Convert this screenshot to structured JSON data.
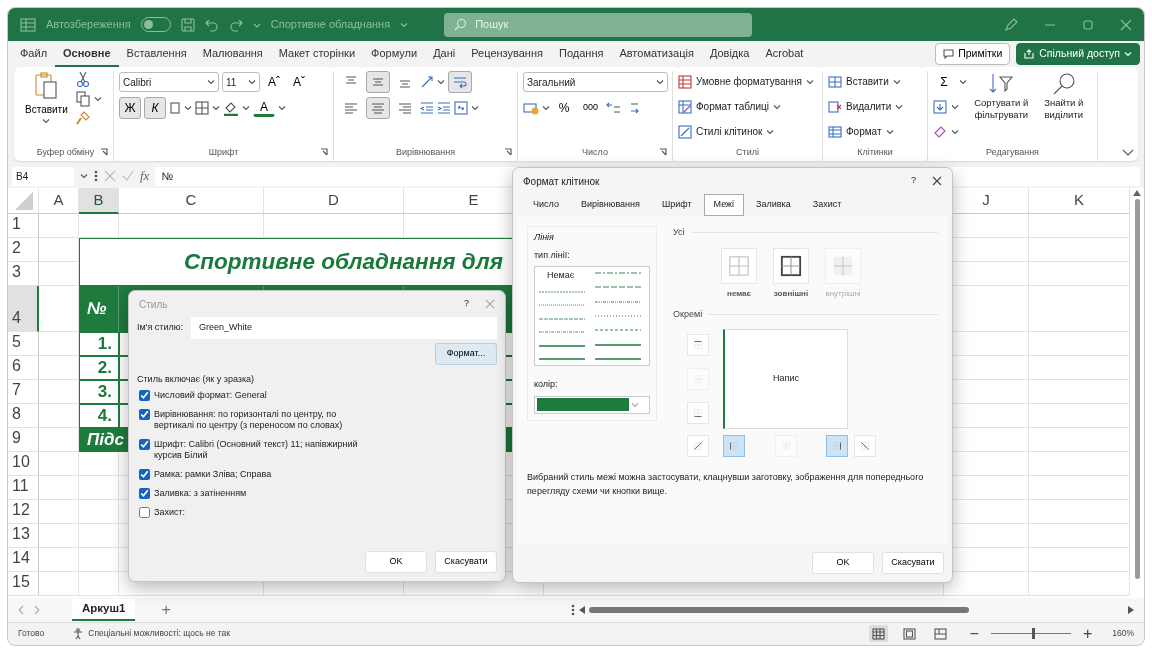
{
  "window": {
    "autosave_label": "Автозбереження",
    "autosave_on": false,
    "document_title": "Спортивне обладнання",
    "search_placeholder": "Пошук"
  },
  "menu_tabs": [
    {
      "label": "Файл",
      "selected": false
    },
    {
      "label": "Основне",
      "selected": true
    },
    {
      "label": "Вставлення",
      "selected": false
    },
    {
      "label": "Малювання",
      "selected": false
    },
    {
      "label": "Макет сторінки",
      "selected": false
    },
    {
      "label": "Формули",
      "selected": false
    },
    {
      "label": "Дані",
      "selected": false
    },
    {
      "label": "Рецензування",
      "selected": false
    },
    {
      "label": "Подання",
      "selected": false
    },
    {
      "label": "Автоматизація",
      "selected": false
    },
    {
      "label": "Довідка",
      "selected": false
    },
    {
      "label": "Acrobat",
      "selected": false
    }
  ],
  "header_buttons": {
    "comments": "Примітки",
    "share": "Спільний доступ"
  },
  "ribbon": {
    "paste": "Вставити",
    "font_name": "Calibri",
    "font_size": "11",
    "grow_font": "Aˆ",
    "shrink_font": "Aˇ",
    "bold": "Ж",
    "bold_on": true,
    "italic": "К",
    "italic_on": true,
    "font_color": "A",
    "align_buttons": [
      {
        "kind": "top",
        "selected": false
      },
      {
        "kind": "middle",
        "selected": true
      },
      {
        "kind": "bottom",
        "selected": false
      },
      {
        "kind": "left",
        "selected": false
      },
      {
        "kind": "center",
        "selected": true
      },
      {
        "kind": "right",
        "selected": false
      }
    ],
    "wrap_on": true,
    "number_format": "Загальний",
    "percent": "%",
    "thousands": "000",
    "styles": [
      "Умовне форматування",
      "Формат таблиці",
      "Стилі клітинок"
    ],
    "cells": [
      "Вставити",
      "Видалити",
      "Формат"
    ],
    "autosum": "Σ",
    "sort": "Сортувати й фільтрувати",
    "find": "Знайти й виділити",
    "groups": [
      {
        "label": "Буфер обміну",
        "launcher": true
      },
      {
        "label": "Шрифт",
        "launcher": true
      },
      {
        "label": "Вирівнювання",
        "launcher": true
      },
      {
        "label": "Число",
        "launcher": true
      },
      {
        "label": "Стилі",
        "launcher": false
      },
      {
        "label": "Клітинки",
        "launcher": false
      },
      {
        "label": "Редагування",
        "launcher": false
      }
    ]
  },
  "formula_bar": {
    "name_box": "B4",
    "function_symbol": "fx",
    "formula": "№"
  },
  "sheet": {
    "columns": [
      {
        "label": "A",
        "selected": false
      },
      {
        "label": "B",
        "selected": true
      },
      {
        "label": "C",
        "selected": false
      },
      {
        "label": "D",
        "selected": false
      },
      {
        "label": "E",
        "selected": false
      },
      {
        "label": "J",
        "selected": false
      },
      {
        "label": "K",
        "selected": false
      }
    ],
    "rows": [
      {
        "label": "1",
        "selected": false
      },
      {
        "label": "2",
        "selected": false
      },
      {
        "label": "3",
        "selected": false
      },
      {
        "label": "4",
        "selected": true
      },
      {
        "label": "5",
        "selected": false
      },
      {
        "label": "6",
        "selected": false
      },
      {
        "label": "7",
        "selected": false
      },
      {
        "label": "8",
        "selected": false
      },
      {
        "label": "9",
        "selected": false
      },
      {
        "label": "10",
        "selected": false
      },
      {
        "label": "11",
        "selected": false
      },
      {
        "label": "12",
        "selected": false
      },
      {
        "label": "13",
        "selected": false
      },
      {
        "label": "14",
        "selected": false
      },
      {
        "label": "15",
        "selected": false
      }
    ],
    "table": {
      "title": "Спортивне обладнання для",
      "number_header": "№",
      "numbers": [
        "1.",
        "2.",
        "3.",
        "4."
      ],
      "total": "Підс"
    }
  },
  "style_dialog": {
    "title": "Стиль",
    "help": "?",
    "name_label": "Ім'я стилю:",
    "name_value": "Green_White",
    "format_button": "Формат...",
    "includes_label": "Стиль включає (як у зразка)",
    "items": [
      {
        "label": "Числовий формат: General",
        "checked": true
      },
      {
        "label": "Вирівнювання: по горизонталі по центру, по вертикалі по центру (з переносом по словах)",
        "checked": true
      },
      {
        "label": "Шрифт: Calibri (Основний текст) 11; напівжирний курсив Білий",
        "checked": true
      },
      {
        "label": "Рамка: рамки Зліва; Справа",
        "checked": true
      },
      {
        "label": "Заливка: з затіненням",
        "checked": true
      },
      {
        "label": "Захист:",
        "checked": false
      }
    ],
    "ok": "OK",
    "cancel": "Скасувати"
  },
  "format_dialog": {
    "title": "Формат клітинок",
    "help": "?",
    "tabs": [
      {
        "label": "Число",
        "selected": false
      },
      {
        "label": "Вирівнювання",
        "selected": false
      },
      {
        "label": "Шрифт",
        "selected": false
      },
      {
        "label": "Межі",
        "selected": true
      },
      {
        "label": "Заливка",
        "selected": false
      },
      {
        "label": "Захист",
        "selected": false
      }
    ],
    "line_group": "Лінія",
    "line_type_label": "тип лінії:",
    "line_none": "Немає",
    "color_label": "колір:",
    "color": "#1e7b3e",
    "presets_label": "Усі",
    "presets": [
      {
        "kind": "none",
        "label": "немає",
        "disabled": false
      },
      {
        "kind": "outline",
        "label": "зовнішні",
        "disabled": false
      },
      {
        "kind": "inside",
        "label": "внутрішні",
        "disabled": true
      }
    ],
    "individual_label": "Окремі",
    "border_buttons": [
      {
        "kind": "top",
        "selected": false,
        "disabled": false
      },
      {
        "kind": "horizontal",
        "selected": false,
        "disabled": true
      },
      {
        "kind": "bottom",
        "selected": false,
        "disabled": false
      },
      {
        "kind": "diagonal-up",
        "selected": false,
        "disabled": false
      },
      {
        "kind": "left",
        "selected": true,
        "disabled": false
      },
      {
        "kind": "vertical",
        "selected": false,
        "disabled": true
      },
      {
        "kind": "right",
        "selected": true,
        "disabled": false
      },
      {
        "kind": "diagonal-down",
        "selected": false,
        "disabled": false
      }
    ],
    "preview_text": "Напис",
    "preview_left_border": true,
    "hint": "Вибраний стиль межі можна застосувати, клацнувши заготовку, зображення для попереднього перегляду схеми чи кнопки вище.",
    "ok": "OK",
    "cancel": "Скасувати"
  },
  "sheet_tabs": {
    "sheets": [
      {
        "label": "Аркуш1",
        "selected": true
      }
    ],
    "add": "+"
  },
  "status_bar": {
    "ready": "Готово",
    "accessibility": "Спеціальні можливості: щось не так",
    "views": [
      {
        "kind": "normal",
        "selected": true
      },
      {
        "kind": "page-layout",
        "selected": false
      },
      {
        "kind": "page-break",
        "selected": false
      }
    ],
    "zoom_out": "−",
    "zoom_slider": {
      "level": 0.52
    },
    "zoom_in": "+",
    "zoom": "160%"
  }
}
